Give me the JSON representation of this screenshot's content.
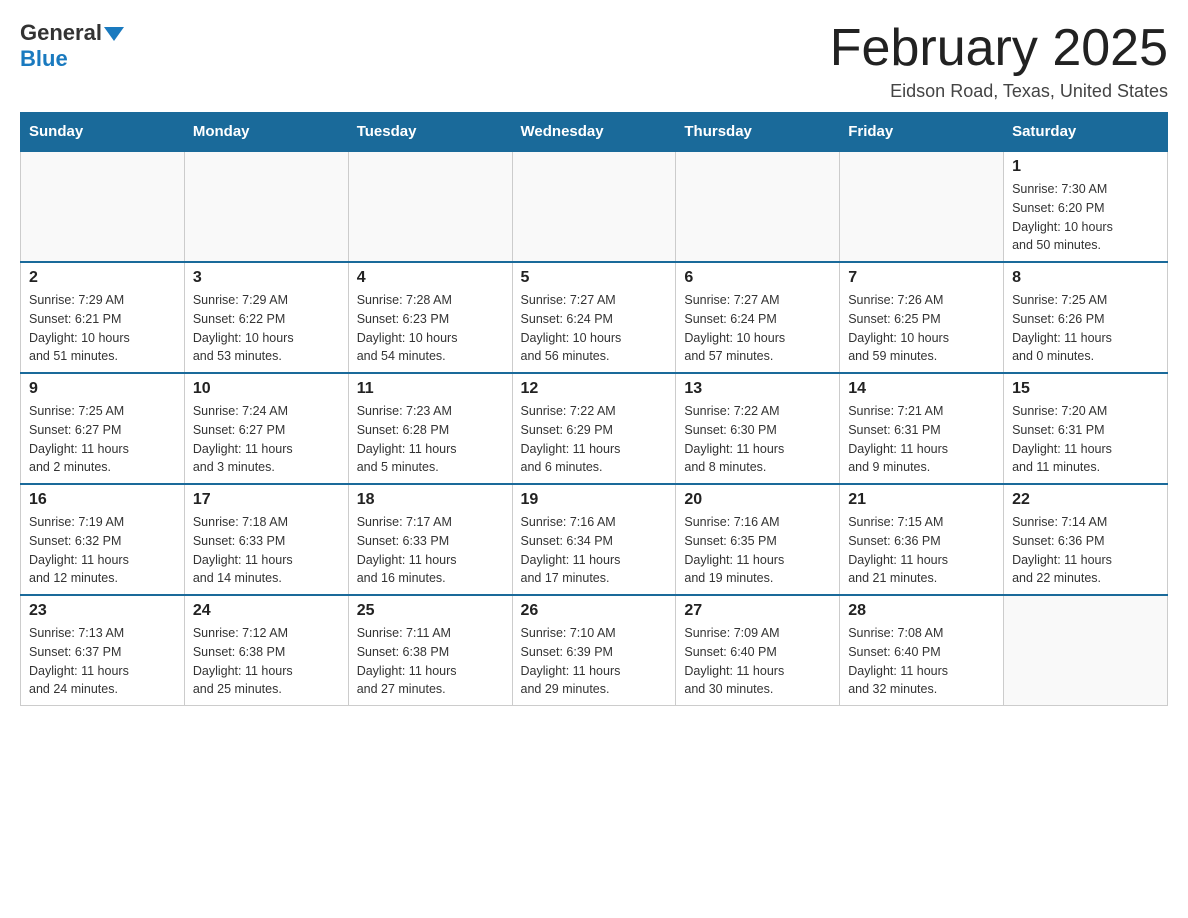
{
  "header": {
    "logo_general": "General",
    "logo_blue": "Blue",
    "title": "February 2025",
    "subtitle": "Eidson Road, Texas, United States"
  },
  "weekdays": [
    "Sunday",
    "Monday",
    "Tuesday",
    "Wednesday",
    "Thursday",
    "Friday",
    "Saturday"
  ],
  "weeks": [
    [
      {
        "day": "",
        "info": ""
      },
      {
        "day": "",
        "info": ""
      },
      {
        "day": "",
        "info": ""
      },
      {
        "day": "",
        "info": ""
      },
      {
        "day": "",
        "info": ""
      },
      {
        "day": "",
        "info": ""
      },
      {
        "day": "1",
        "info": "Sunrise: 7:30 AM\nSunset: 6:20 PM\nDaylight: 10 hours\nand 50 minutes."
      }
    ],
    [
      {
        "day": "2",
        "info": "Sunrise: 7:29 AM\nSunset: 6:21 PM\nDaylight: 10 hours\nand 51 minutes."
      },
      {
        "day": "3",
        "info": "Sunrise: 7:29 AM\nSunset: 6:22 PM\nDaylight: 10 hours\nand 53 minutes."
      },
      {
        "day": "4",
        "info": "Sunrise: 7:28 AM\nSunset: 6:23 PM\nDaylight: 10 hours\nand 54 minutes."
      },
      {
        "day": "5",
        "info": "Sunrise: 7:27 AM\nSunset: 6:24 PM\nDaylight: 10 hours\nand 56 minutes."
      },
      {
        "day": "6",
        "info": "Sunrise: 7:27 AM\nSunset: 6:24 PM\nDaylight: 10 hours\nand 57 minutes."
      },
      {
        "day": "7",
        "info": "Sunrise: 7:26 AM\nSunset: 6:25 PM\nDaylight: 10 hours\nand 59 minutes."
      },
      {
        "day": "8",
        "info": "Sunrise: 7:25 AM\nSunset: 6:26 PM\nDaylight: 11 hours\nand 0 minutes."
      }
    ],
    [
      {
        "day": "9",
        "info": "Sunrise: 7:25 AM\nSunset: 6:27 PM\nDaylight: 11 hours\nand 2 minutes."
      },
      {
        "day": "10",
        "info": "Sunrise: 7:24 AM\nSunset: 6:27 PM\nDaylight: 11 hours\nand 3 minutes."
      },
      {
        "day": "11",
        "info": "Sunrise: 7:23 AM\nSunset: 6:28 PM\nDaylight: 11 hours\nand 5 minutes."
      },
      {
        "day": "12",
        "info": "Sunrise: 7:22 AM\nSunset: 6:29 PM\nDaylight: 11 hours\nand 6 minutes."
      },
      {
        "day": "13",
        "info": "Sunrise: 7:22 AM\nSunset: 6:30 PM\nDaylight: 11 hours\nand 8 minutes."
      },
      {
        "day": "14",
        "info": "Sunrise: 7:21 AM\nSunset: 6:31 PM\nDaylight: 11 hours\nand 9 minutes."
      },
      {
        "day": "15",
        "info": "Sunrise: 7:20 AM\nSunset: 6:31 PM\nDaylight: 11 hours\nand 11 minutes."
      }
    ],
    [
      {
        "day": "16",
        "info": "Sunrise: 7:19 AM\nSunset: 6:32 PM\nDaylight: 11 hours\nand 12 minutes."
      },
      {
        "day": "17",
        "info": "Sunrise: 7:18 AM\nSunset: 6:33 PM\nDaylight: 11 hours\nand 14 minutes."
      },
      {
        "day": "18",
        "info": "Sunrise: 7:17 AM\nSunset: 6:33 PM\nDaylight: 11 hours\nand 16 minutes."
      },
      {
        "day": "19",
        "info": "Sunrise: 7:16 AM\nSunset: 6:34 PM\nDaylight: 11 hours\nand 17 minutes."
      },
      {
        "day": "20",
        "info": "Sunrise: 7:16 AM\nSunset: 6:35 PM\nDaylight: 11 hours\nand 19 minutes."
      },
      {
        "day": "21",
        "info": "Sunrise: 7:15 AM\nSunset: 6:36 PM\nDaylight: 11 hours\nand 21 minutes."
      },
      {
        "day": "22",
        "info": "Sunrise: 7:14 AM\nSunset: 6:36 PM\nDaylight: 11 hours\nand 22 minutes."
      }
    ],
    [
      {
        "day": "23",
        "info": "Sunrise: 7:13 AM\nSunset: 6:37 PM\nDaylight: 11 hours\nand 24 minutes."
      },
      {
        "day": "24",
        "info": "Sunrise: 7:12 AM\nSunset: 6:38 PM\nDaylight: 11 hours\nand 25 minutes."
      },
      {
        "day": "25",
        "info": "Sunrise: 7:11 AM\nSunset: 6:38 PM\nDaylight: 11 hours\nand 27 minutes."
      },
      {
        "day": "26",
        "info": "Sunrise: 7:10 AM\nSunset: 6:39 PM\nDaylight: 11 hours\nand 29 minutes."
      },
      {
        "day": "27",
        "info": "Sunrise: 7:09 AM\nSunset: 6:40 PM\nDaylight: 11 hours\nand 30 minutes."
      },
      {
        "day": "28",
        "info": "Sunrise: 7:08 AM\nSunset: 6:40 PM\nDaylight: 11 hours\nand 32 minutes."
      },
      {
        "day": "",
        "info": ""
      }
    ]
  ]
}
